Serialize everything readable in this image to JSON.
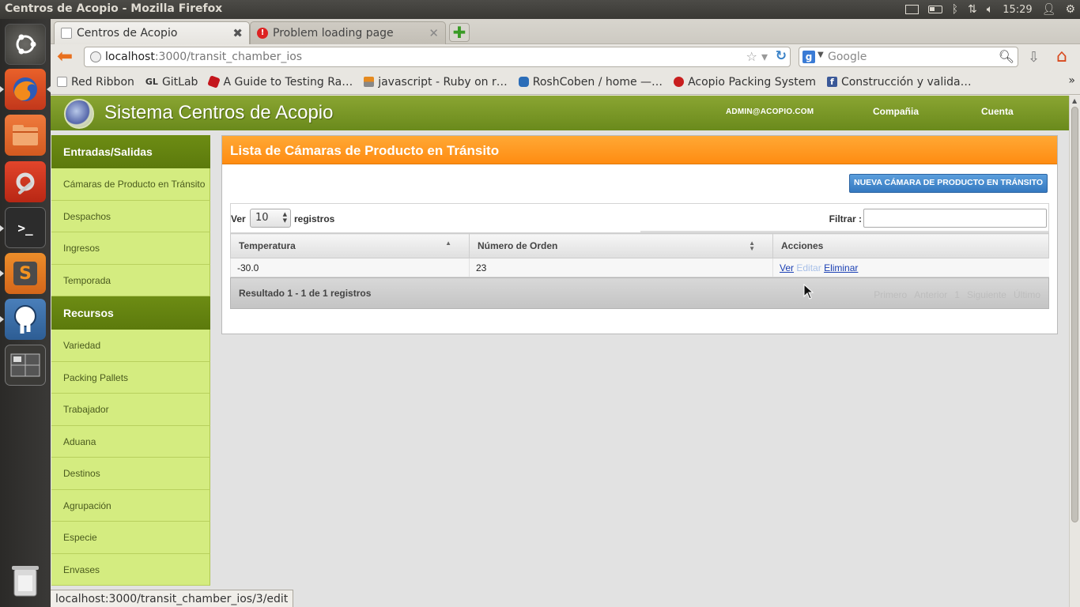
{
  "os": {
    "window_title": "Centros de Acopio - Mozilla Firefox",
    "clock": "15:29"
  },
  "browser": {
    "tabs": [
      {
        "label": "Centros de Acopio",
        "active": true
      },
      {
        "label": "Problem loading page",
        "active": false
      }
    ],
    "url_host": "localhost",
    "url_path": ":3000/transit_chamber_ios",
    "search_placeholder": "Google",
    "bookmarks": [
      {
        "label": "Red Ribbon",
        "color": "#ffffff"
      },
      {
        "label": "GitLab",
        "prefix": "GL"
      },
      {
        "label": "A Guide to Testing Ra…",
        "color": "#c4161c"
      },
      {
        "label": "javascript - Ruby on r…",
        "color": "#e58a1f"
      },
      {
        "label": "RoshCoben / home —…",
        "color": "#2b6db8"
      },
      {
        "label": "Acopio Packing System",
        "color": "#c81e1e"
      },
      {
        "label": "Construcción y valida…",
        "color": "#3b5998"
      }
    ],
    "status_url": "localhost:3000/transit_chamber_ios/3/edit"
  },
  "app": {
    "title": "Sistema Centros de Acopio",
    "user_email": "ADMIN@ACOPIO.COM",
    "nav_company": "Compañia",
    "nav_account": "Cuenta",
    "accent_green": "#6d8c14",
    "accent_orange": "#ff9a20"
  },
  "sidebar": {
    "section1": "Entradas/Salidas",
    "items1": [
      "Cámaras de Producto en Tránsito",
      "Despachos",
      "Ingresos",
      "Temporada"
    ],
    "section2": "Recursos",
    "items2": [
      "Variedad",
      "Packing Pallets",
      "Trabajador",
      "Aduana",
      "Destinos",
      "Agrupación",
      "Especie",
      "Envases"
    ]
  },
  "panel": {
    "title": "Lista de Cámaras de Producto en Tránsito",
    "new_button": "NUEVA CÁMARA DE PRODUCTO EN TRÁNSITO",
    "length_label_pre": "Ver",
    "length_value": "10",
    "length_label_post": "registros",
    "filter_label": "Filtrar :",
    "columns": [
      "Temperatura",
      "Número de Orden",
      "Acciones"
    ],
    "rows": [
      {
        "temperatura": "-30.0",
        "orden": "23",
        "actions": [
          "Ver",
          "Editar",
          "Eliminar"
        ]
      }
    ],
    "info": "Resultado 1 - 1 de 1 registros",
    "pager": [
      "Primero",
      "Anterior",
      "1",
      "Siguiente",
      "Último"
    ]
  }
}
